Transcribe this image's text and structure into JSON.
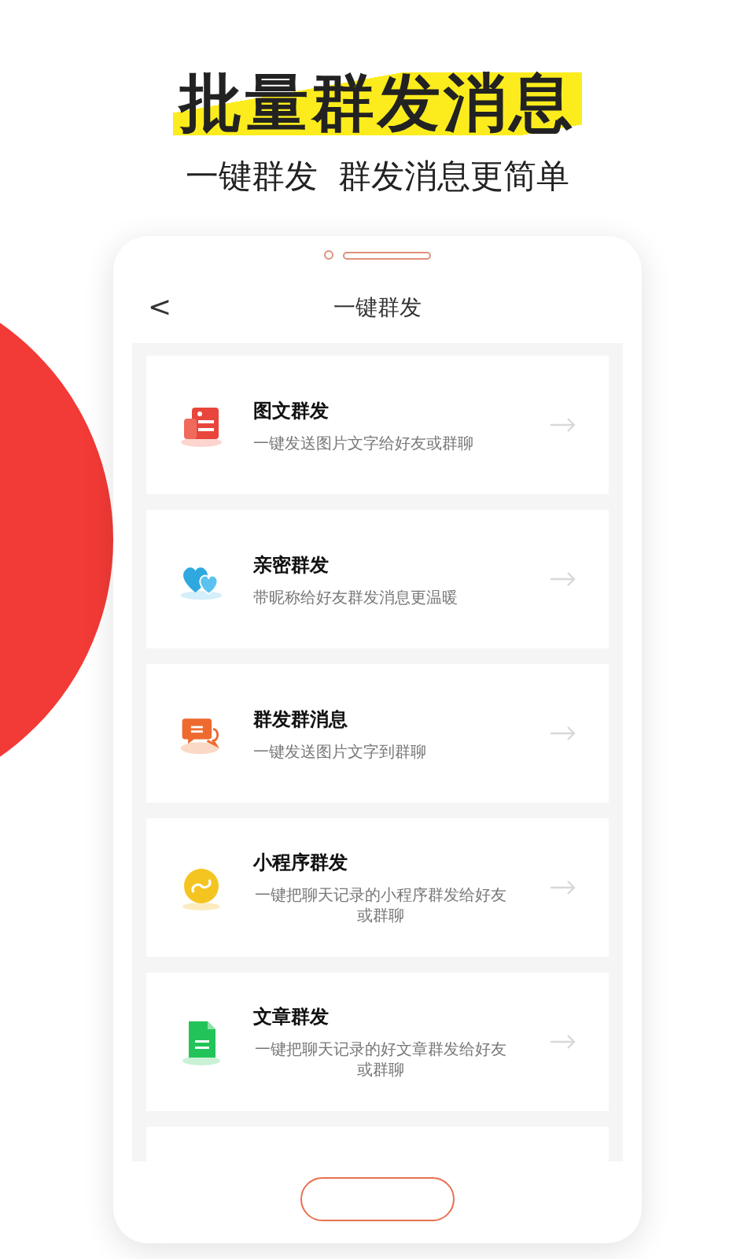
{
  "headline": "批量群发消息",
  "subtitle": "一键群发  群发消息更简单",
  "screen": {
    "title": "一键群发",
    "back": "<"
  },
  "features": [
    {
      "kind": "image-text",
      "title": "图文群发",
      "desc": "一键发送图片文字给好友或群聊"
    },
    {
      "kind": "hearts",
      "title": "亲密群发",
      "desc": "带昵称给好友群发消息更温暖"
    },
    {
      "kind": "chat",
      "title": "群发群消息",
      "desc": "一键发送图片文字到群聊"
    },
    {
      "kind": "mini-program",
      "title": "小程序群发",
      "desc": "一键把聊天记录的小程序群发给好友或群聊"
    },
    {
      "kind": "article",
      "title": "文章群发",
      "desc": "一键把聊天记录的好文章群发给好友或群聊"
    }
  ]
}
